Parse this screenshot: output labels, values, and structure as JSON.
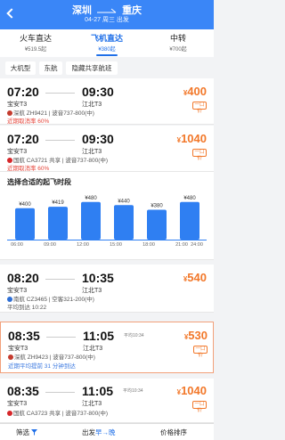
{
  "header": {
    "origin": "深圳",
    "destination": "重庆",
    "subtitle": "04-27 周三 出发"
  },
  "tabs": [
    {
      "label": "火车直达",
      "price": "¥519.5起"
    },
    {
      "label": "飞机直达",
      "price": "¥380起"
    },
    {
      "label": "中转",
      "price": "¥700起"
    }
  ],
  "filters": [
    "大机型",
    "东航",
    "隐藏共享航班"
  ],
  "flights": [
    {
      "dep_time": "07:20",
      "arr_time": "09:30",
      "dep_airport": "宝安T3",
      "arr_airport": "江北T3",
      "price": "400",
      "currency": "¥",
      "fare_badge": "一口价",
      "info": "深航 ZH9421 | 波音737-800(中)",
      "punctuality": "近期取消率 60%"
    },
    {
      "dep_time": "07:20",
      "arr_time": "09:30",
      "dep_airport": "宝安T3",
      "arr_airport": "江北T3",
      "price": "1040",
      "currency": "¥",
      "fare_badge": "一口价",
      "info": "国航 CA3721 共享 | 波音737-800(中)",
      "punctuality": "近期取消率 60%"
    },
    {
      "dep_time": "08:20",
      "arr_time": "10:35",
      "dep_airport": "宝安T3",
      "arr_airport": "江北T3",
      "price": "540",
      "currency": "¥",
      "fare_badge": "",
      "info": "南航 CZ3465 | 空客321-200(中)",
      "punctuality": "平均到达 10:22"
    },
    {
      "dep_time": "08:35",
      "arr_time": "11:05",
      "dep_airport": "宝安T3",
      "arr_airport": "江北T3",
      "price": "530",
      "currency": "¥",
      "fare_badge": "一口价",
      "info": "深航 ZH9423 | 波音737-800(中)",
      "punctuality": "近期平均提前 31 分钟到达",
      "avg_label": "平均10:34"
    },
    {
      "dep_time": "08:35",
      "arr_time": "11:05",
      "dep_airport": "宝安T3",
      "arr_airport": "江北T3",
      "price": "1040",
      "currency": "¥",
      "fare_badge": "一口价",
      "info": "国航 CA3723 共享 | 波音737-800(中)",
      "punctuality": "",
      "avg_label": "平均10:34"
    }
  ],
  "chart": {
    "title": "选择合适的起飞时段",
    "prices": [
      "¥400",
      "¥419",
      "¥480",
      "¥440",
      "¥380",
      "¥480"
    ],
    "ticks": [
      "06:00",
      "09:00",
      "12:00",
      "15:00",
      "18:00",
      "21:00",
      "24:00"
    ]
  },
  "chart_data": {
    "type": "bar",
    "title": "选择合适的起飞时段",
    "categories": [
      "06:00-09:00",
      "09:00-12:00",
      "12:00-15:00",
      "15:00-18:00",
      "18:00-21:00",
      "21:00-24:00"
    ],
    "values": [
      400,
      419,
      480,
      440,
      380,
      480
    ]
  },
  "bottom": {
    "filter_label": "筛选",
    "time_label_prefix": "出发",
    "time_label_accent": "早→晚",
    "price_label": "价格排序"
  },
  "colors": {
    "accent": "#3a86f7",
    "price": "#f2782a"
  }
}
